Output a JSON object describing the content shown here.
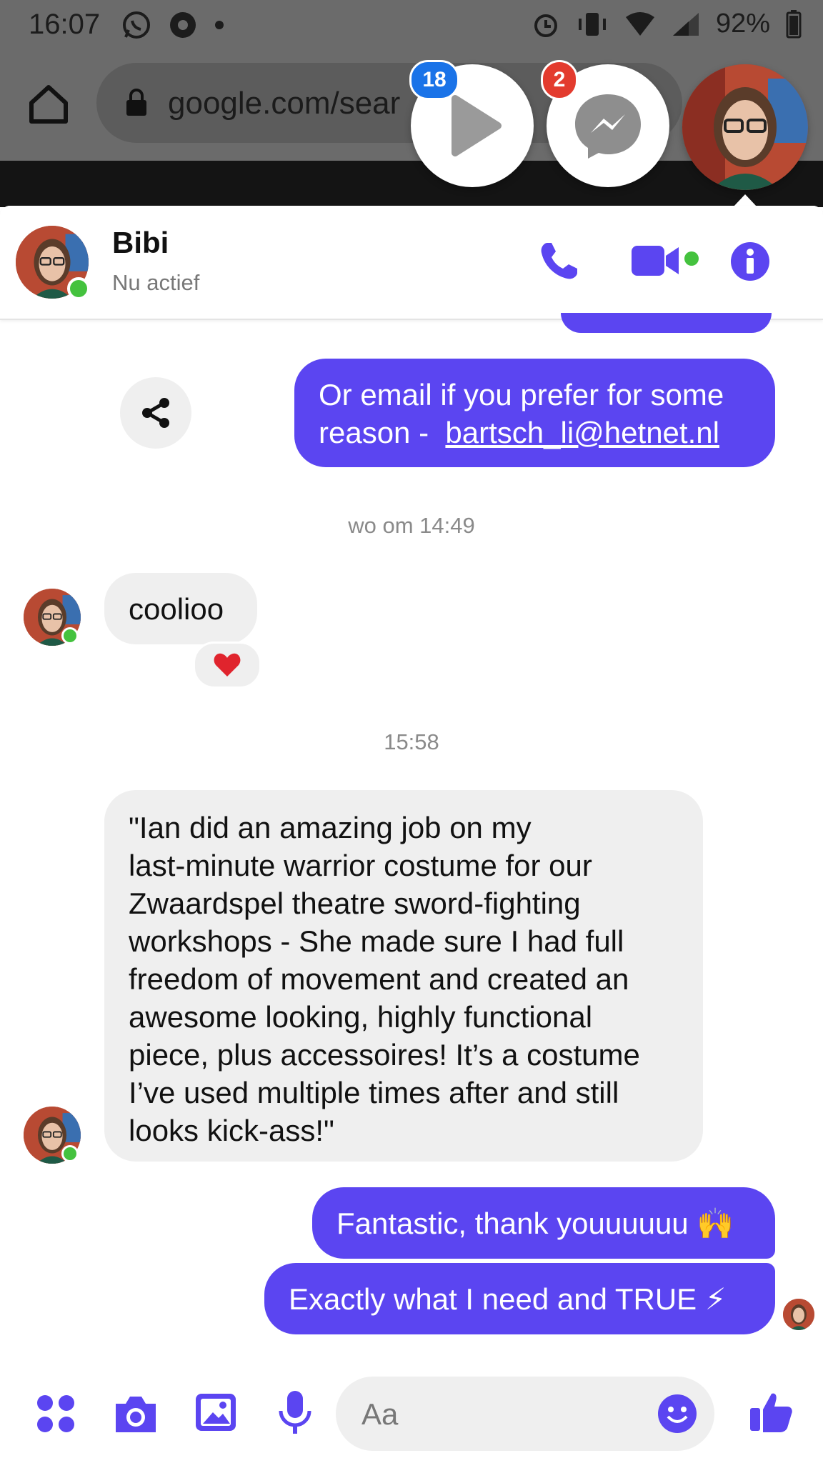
{
  "colors": {
    "accent": "#5b45f1",
    "online": "#44c23e",
    "badge_blue": "#1a73e8",
    "badge_red": "#e33b2e",
    "heart": "#e0242d"
  },
  "status_bar": {
    "time": "16:07",
    "battery": "92%"
  },
  "browser": {
    "url": "google.com/sear"
  },
  "chat_heads": [
    {
      "icon": "play-icon",
      "badge": "18"
    },
    {
      "icon": "messenger-icon",
      "badge": "2"
    },
    {
      "icon": "contact-avatar"
    }
  ],
  "header": {
    "name": "Bibi",
    "status": "Nu actief"
  },
  "messages": {
    "out1_line1": "Or email if you prefer for some",
    "out1_line2_prefix": "reason - ",
    "out1_link": "bartsch_li@hetnet.nl",
    "time1": "wo om 14:49",
    "in1": "coolioo",
    "in1_reaction": "❤️",
    "time2": "15:58",
    "in2_lines": [
      "\"Ian did an amazing job on my",
      "last-minute warrior costume for our",
      "Zwaardspel theatre sword-fighting",
      "workshops - She made sure I had full",
      "freedom of movement and created an",
      "awesome looking, highly functional",
      "piece, plus accessoires! It’s a costume",
      "I’ve used multiple times after and still",
      "looks kick-ass!\""
    ],
    "out2": "Fantastic, thank youuuuuu 🙌",
    "out3": "Exactly what I need and TRUE ⚡"
  },
  "composer": {
    "placeholder": "Aa"
  }
}
